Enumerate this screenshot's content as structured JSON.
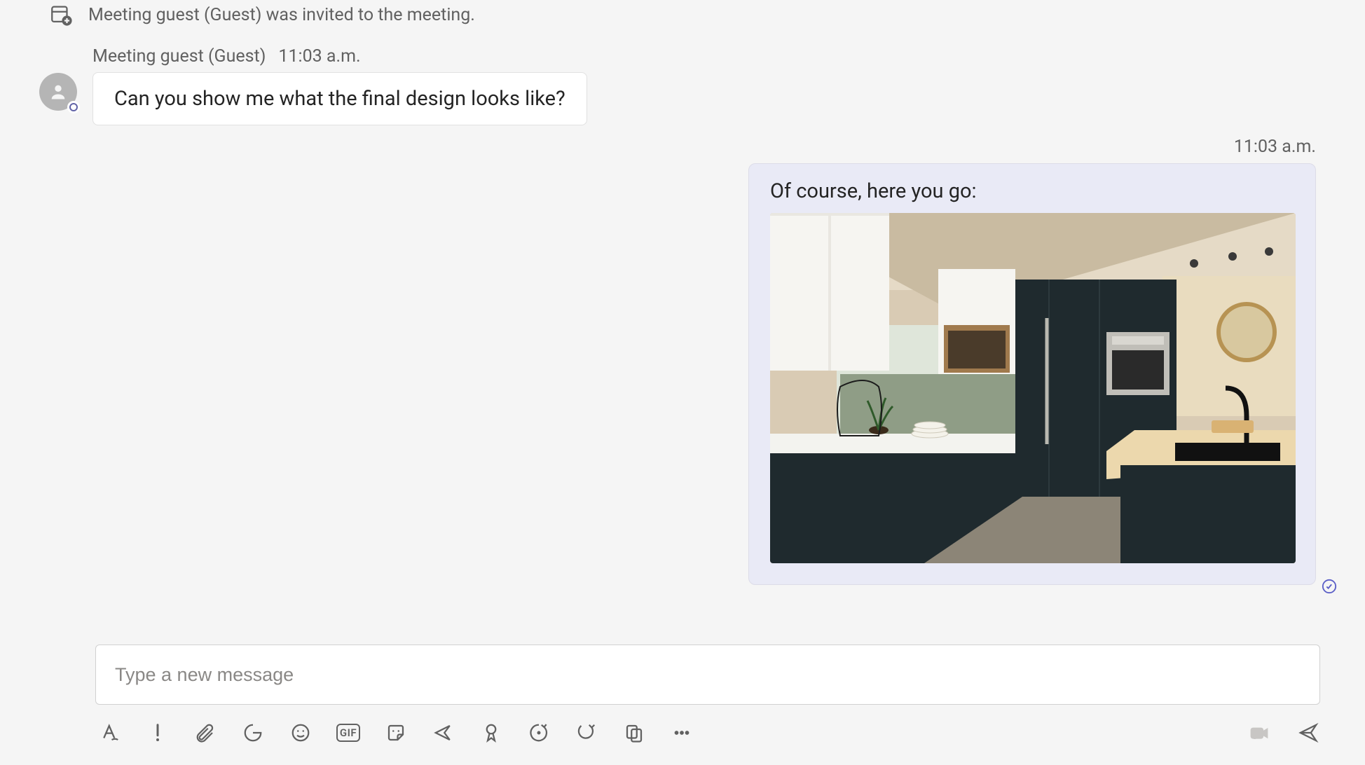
{
  "system": {
    "text": "Meeting guest (Guest) was invited to the meeting."
  },
  "guest": {
    "name": "Meeting guest (Guest)",
    "time": "11:03 a.m.",
    "message": "Can you show me what the final design looks like?",
    "avatar_icon": "person-icon",
    "presence": "unknown"
  },
  "me": {
    "time": "11:03 a.m.",
    "message": "Of course, here you go:",
    "attachment": {
      "type": "image",
      "description": "Modern kitchen interior with dark matte cabinets, light wood island countertop, white upper cabinets, built-in oven, black sink faucet, round mirror on wooden wall."
    },
    "read": true
  },
  "composer": {
    "placeholder": "Type a new message",
    "value": ""
  },
  "toolbar": {
    "format": "A",
    "priority": "!",
    "gif": "GIF"
  }
}
